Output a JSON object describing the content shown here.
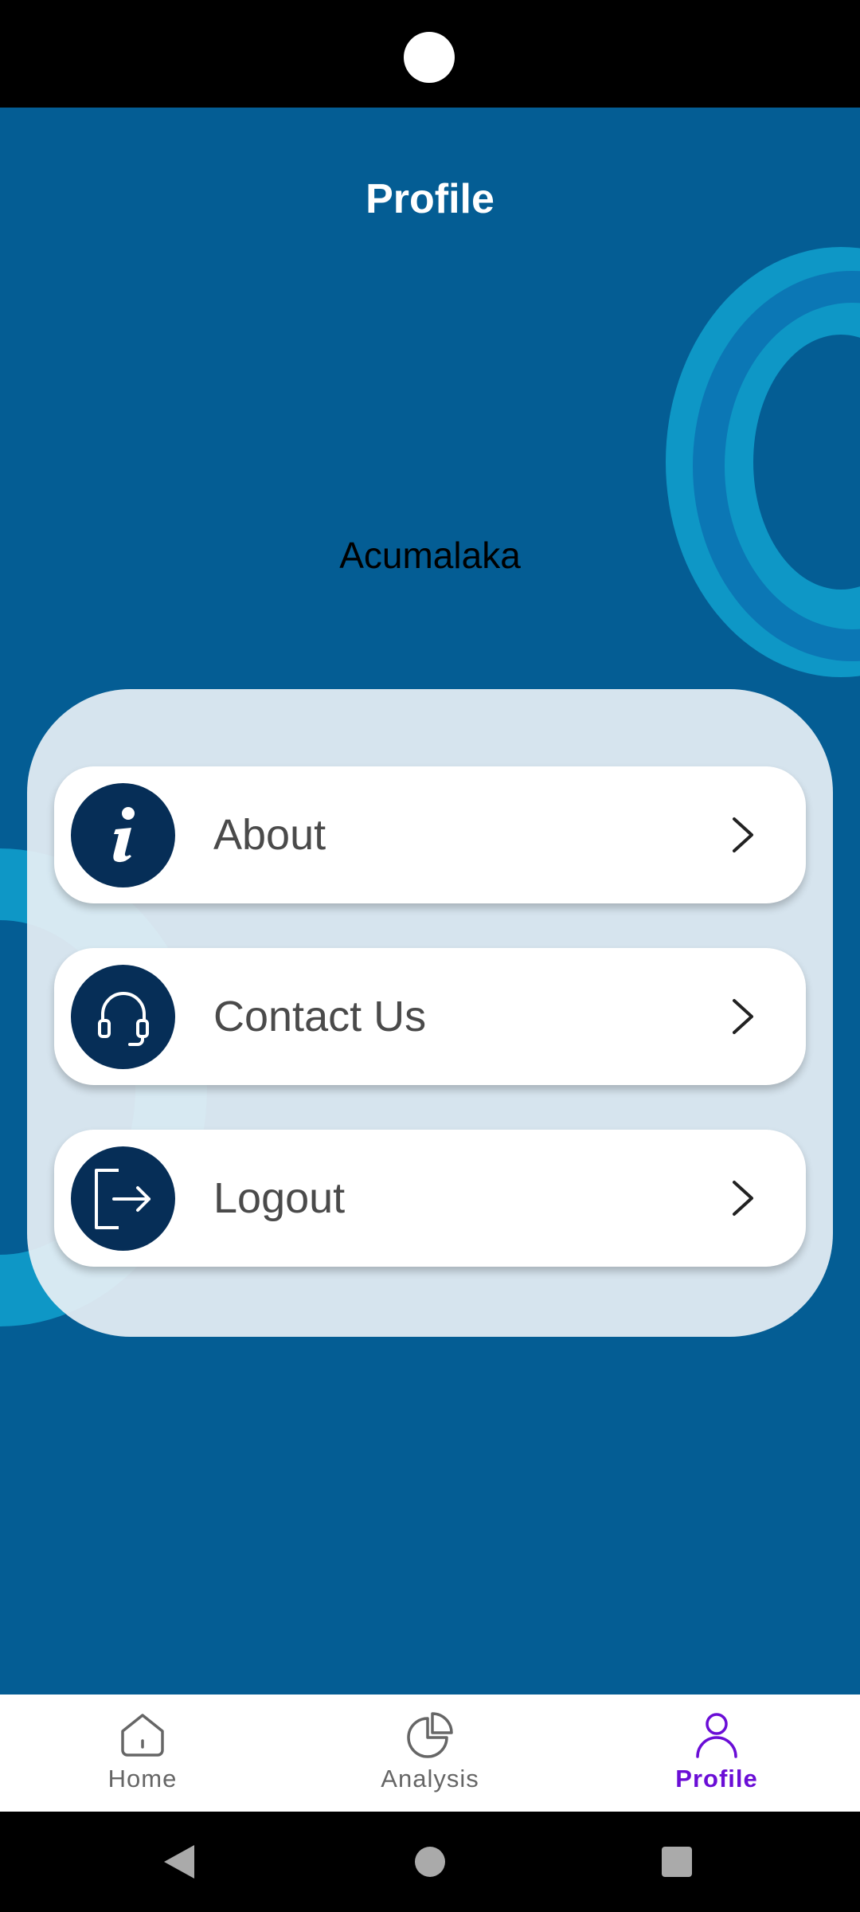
{
  "header": {
    "title": "Profile"
  },
  "profile": {
    "name": "Acumalaka"
  },
  "menu": {
    "items": [
      {
        "label": "About",
        "icon": "info-icon"
      },
      {
        "label": "Contact Us",
        "icon": "headset-icon"
      },
      {
        "label": "Logout",
        "icon": "logout-icon"
      }
    ]
  },
  "bottom_nav": {
    "items": [
      {
        "label": "Home",
        "icon": "home-icon",
        "active": false
      },
      {
        "label": "Analysis",
        "icon": "pie-chart-icon",
        "active": false
      },
      {
        "label": "Profile",
        "icon": "person-icon",
        "active": true
      }
    ]
  },
  "colors": {
    "background": "#045D94",
    "accent_ring": "#0E97C6",
    "icon_circle": "#062E57",
    "active_nav": "#6A0DD6"
  }
}
